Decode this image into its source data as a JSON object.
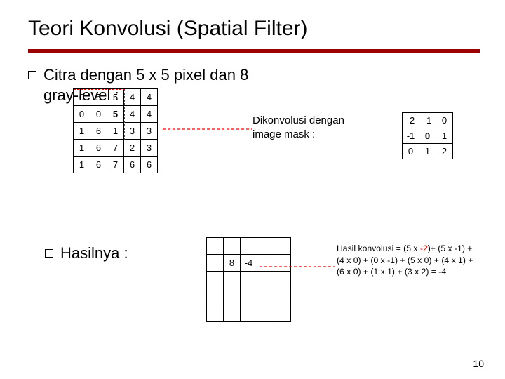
{
  "title": "Teori Konvolusi (Spatial Filter)",
  "bullet1_line1": "Citra dengan 5 x 5 pixel dan 8",
  "bullet1_line2": "gray-level :",
  "mid_line1": "Dikonvolusi dengan",
  "mid_line2": "image mask :",
  "bullet2": "Hasilnya :",
  "citra": [
    [
      "0",
      "5",
      "5",
      "4",
      "4"
    ],
    [
      "0",
      "0",
      "5",
      "4",
      "4"
    ],
    [
      "1",
      "6",
      "1",
      "3",
      "3"
    ],
    [
      "1",
      "6",
      "7",
      "2",
      "3"
    ],
    [
      "1",
      "6",
      "7",
      "6",
      "6"
    ]
  ],
  "mask": [
    [
      "-2",
      "-1",
      "0"
    ],
    [
      "-1",
      "0",
      "1"
    ],
    [
      "0",
      "1",
      "2"
    ]
  ],
  "result_known": {
    "r": 1,
    "c": 1,
    "val": "8"
  },
  "result_new": {
    "r": 1,
    "c": 2,
    "val": "-4"
  },
  "conv_l1a": "Hasil konvolusi = (5 x ",
  "conv_l1b": "-2",
  "conv_l1c": ")+ (5 x -1) +",
  "conv_l2": "(4 x 0) + (0 x -1) + (5 x 0) + (4 x 1) +",
  "conv_l3": "(6 x 0) + (1 x 1) + (3 x 2) = -4",
  "slide_number": "10"
}
